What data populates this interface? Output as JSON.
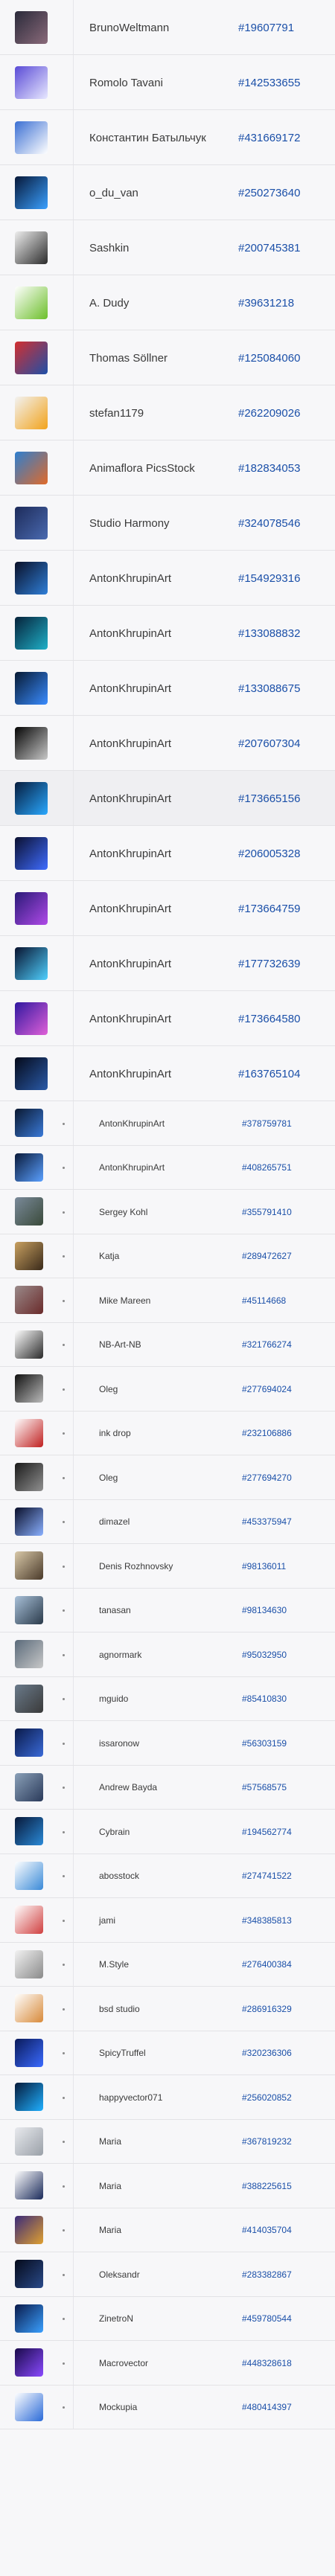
{
  "contributors": [
    {
      "name": "BrunoWeltmann",
      "id": "#19607791",
      "icon": "portrait-thumbnail",
      "colors": [
        "#2a2a3a",
        "#8a6a7a"
      ]
    },
    {
      "name": "Romolo Tavani",
      "id": "#142533655",
      "icon": "abstract-thumbnail",
      "colors": [
        "#5a4bd6",
        "#e8e8ff"
      ]
    },
    {
      "name": "Константин Батыльчук",
      "id": "#431669172",
      "icon": "business-thumbnail",
      "colors": [
        "#3b6fd3",
        "#ffffff"
      ]
    },
    {
      "name": "o_du_van",
      "id": "#250273640",
      "icon": "neon-thumbnail",
      "colors": [
        "#071838",
        "#3aa0ff"
      ]
    },
    {
      "name": "Sashkin",
      "id": "#200745381",
      "icon": "car-battery-thumbnail",
      "colors": [
        "#eeeeee",
        "#2c2c2c"
      ]
    },
    {
      "name": "A. Dudy",
      "id": "#39631218",
      "icon": "sticker-thumbnail",
      "colors": [
        "#ffffff",
        "#6cbf2a"
      ]
    },
    {
      "name": "Thomas Söllner",
      "id": "#125084060",
      "icon": "flags-thumbnail",
      "colors": [
        "#d32f2f",
        "#1e4fa8"
      ]
    },
    {
      "name": "stefan1179",
      "id": "#262209026",
      "icon": "forklift-thumbnail",
      "colors": [
        "#f2f2f2",
        "#f2a31b"
      ]
    },
    {
      "name": "Animaflora PicsStock",
      "id": "#182834053",
      "icon": "landscape-thumbnail",
      "colors": [
        "#2d7fd0",
        "#e06a2a"
      ]
    },
    {
      "name": "Studio Harmony",
      "id": "#324078546",
      "icon": "solar-panel-thumbnail",
      "colors": [
        "#1d2b5a",
        "#4a6ab0"
      ]
    },
    {
      "name": "AntonKhrupinArt",
      "id": "#154929316",
      "icon": "space-thumbnail",
      "colors": [
        "#0a1028",
        "#2f7fd8"
      ]
    },
    {
      "name": "AntonKhrupinArt",
      "id": "#133088832",
      "icon": "space-thumbnail",
      "colors": [
        "#06223a",
        "#1fb0c8"
      ]
    },
    {
      "name": "AntonKhrupinArt",
      "id": "#133088675",
      "icon": "space-thumbnail",
      "colors": [
        "#071a33",
        "#3a8cff"
      ]
    },
    {
      "name": "AntonKhrupinArt",
      "id": "#207607304",
      "icon": "space-thumbnail",
      "colors": [
        "#050505",
        "#c8c8c8"
      ]
    },
    {
      "name": "AntonKhrupinArt",
      "id": "#173665156",
      "icon": "space-thumbnail",
      "colors": [
        "#061c3d",
        "#29a8ff"
      ]
    },
    {
      "name": "AntonKhrupinArt",
      "id": "#206005328",
      "icon": "space-thumbnail",
      "colors": [
        "#0b1030",
        "#3f6cff"
      ]
    },
    {
      "name": "AntonKhrupinArt",
      "id": "#173664759",
      "icon": "space-thumbnail",
      "colors": [
        "#2a1a78",
        "#b04ae8"
      ]
    },
    {
      "name": "AntonKhrupinArt",
      "id": "#177732639",
      "icon": "space-thumbnail",
      "colors": [
        "#08122e",
        "#4fd0ff"
      ]
    },
    {
      "name": "AntonKhrupinArt",
      "id": "#173664580",
      "icon": "space-thumbnail",
      "colors": [
        "#3018a0",
        "#e060d8"
      ]
    },
    {
      "name": "AntonKhrupinArt",
      "id": "#163765104",
      "icon": "space-thumbnail",
      "colors": [
        "#050a1a",
        "#2a5aa8"
      ]
    },
    {
      "name": "AntonKhrupinArt",
      "id": "#378759781",
      "icon": "space-thumbnail",
      "colors": [
        "#0a1830",
        "#3a7ad8"
      ]
    },
    {
      "name": "AntonKhrupinArt",
      "id": "#408265751",
      "icon": "space-thumbnail",
      "colors": [
        "#0a1a3a",
        "#5aa0ff"
      ]
    },
    {
      "name": "Sergey Kohl",
      "id": "#355791410",
      "icon": "photo-thumbnail",
      "colors": [
        "#7a8a9a",
        "#3a4a3a"
      ]
    },
    {
      "name": "Katja",
      "id": "#289472627",
      "icon": "photo-thumbnail",
      "colors": [
        "#c8a060",
        "#3a2a1a"
      ]
    },
    {
      "name": "Mike Mareen",
      "id": "#45114668",
      "icon": "photo-thumbnail",
      "colors": [
        "#9a8a8a",
        "#6a2a2a"
      ]
    },
    {
      "name": "NB-Art-NB",
      "id": "#321766274",
      "icon": "waves-thumbnail",
      "colors": [
        "#ffffff",
        "#2a2a2a"
      ]
    },
    {
      "name": "Oleg",
      "id": "#277694024",
      "icon": "abstract-thumbnail",
      "colors": [
        "#111111",
        "#bbbbbb"
      ]
    },
    {
      "name": "ink drop",
      "id": "#232106886",
      "icon": "bottles-thumbnail",
      "colors": [
        "#ffffff",
        "#c02020"
      ]
    },
    {
      "name": "Oleg",
      "id": "#277694270",
      "icon": "abstract-thumbnail",
      "colors": [
        "#1a1a1a",
        "#909090"
      ]
    },
    {
      "name": "dimazel",
      "id": "#453375947",
      "icon": "space-thumbnail",
      "colors": [
        "#0a0f2a",
        "#8ab0ff"
      ]
    },
    {
      "name": "Denis Rozhnovsky",
      "id": "#98136011",
      "icon": "photo-thumbnail",
      "colors": [
        "#d8c8a8",
        "#4a3a2a"
      ]
    },
    {
      "name": "tanasan",
      "id": "#98134630",
      "icon": "photo-thumbnail",
      "colors": [
        "#a8c0d8",
        "#2a3a4a"
      ]
    },
    {
      "name": "agnormark",
      "id": "#95032950",
      "icon": "photo-thumbnail",
      "colors": [
        "#5a6a7a",
        "#c8c8c8"
      ]
    },
    {
      "name": "mguido",
      "id": "#85410830",
      "icon": "photo-thumbnail",
      "colors": [
        "#6a7a8a",
        "#3a3a3a"
      ]
    },
    {
      "name": "issaronow",
      "id": "#56303159",
      "icon": "space-thumbnail",
      "colors": [
        "#0a1a4a",
        "#3a6ad8"
      ]
    },
    {
      "name": "Andrew Bayda",
      "id": "#57568575",
      "icon": "photo-thumbnail",
      "colors": [
        "#8aa0b8",
        "#2a3a5a"
      ]
    },
    {
      "name": "Cybrain",
      "id": "#194562774",
      "icon": "space-thumbnail",
      "colors": [
        "#081838",
        "#2a8ad8"
      ]
    },
    {
      "name": "abosstock",
      "id": "#274741522",
      "icon": "sticker-thumbnail",
      "colors": [
        "#ffffff",
        "#3a8ad8"
      ]
    },
    {
      "name": "jami",
      "id": "#348385813",
      "icon": "icons-thumbnail",
      "colors": [
        "#ffffff",
        "#d04040"
      ]
    },
    {
      "name": "M.Style",
      "id": "#276400384",
      "icon": "document-thumbnail",
      "colors": [
        "#f2f2f2",
        "#8a8a8a"
      ]
    },
    {
      "name": "bsd studio",
      "id": "#286916329",
      "icon": "document-thumbnail",
      "colors": [
        "#ffffff",
        "#d88a3a"
      ]
    },
    {
      "name": "SpicyTruffel",
      "id": "#320236306",
      "icon": "neon-thumbnail",
      "colors": [
        "#0a1a5a",
        "#3a6aff"
      ]
    },
    {
      "name": "happyvector071",
      "id": "#256020852",
      "icon": "neon-thumbnail",
      "colors": [
        "#061a3a",
        "#1fb0ff"
      ]
    },
    {
      "name": "Maria",
      "id": "#367819232",
      "icon": "map-thumbnail",
      "colors": [
        "#e8eaee",
        "#9aa0a8"
      ]
    },
    {
      "name": "Maria",
      "id": "#388225615",
      "icon": "grid-thumbnail",
      "colors": [
        "#ffffff",
        "#1a2a5a"
      ]
    },
    {
      "name": "Maria",
      "id": "#414035704",
      "icon": "map-thumbnail",
      "colors": [
        "#3a2a7a",
        "#e0a030"
      ]
    },
    {
      "name": "Oleksandr",
      "id": "#283382867",
      "icon": "space-thumbnail",
      "colors": [
        "#050a1a",
        "#2a4a8a"
      ]
    },
    {
      "name": "ZinetroN",
      "id": "#459780544",
      "icon": "chip-thumbnail",
      "colors": [
        "#0a1a4a",
        "#3aa0ff"
      ]
    },
    {
      "name": "Macrovector",
      "id": "#448328618",
      "icon": "neon-thumbnail",
      "colors": [
        "#1a0a4a",
        "#8a4aff"
      ]
    },
    {
      "name": "Mockupia",
      "id": "#480414397",
      "icon": "card-thumbnail",
      "colors": [
        "#ffffff",
        "#2a6ad8"
      ]
    }
  ]
}
